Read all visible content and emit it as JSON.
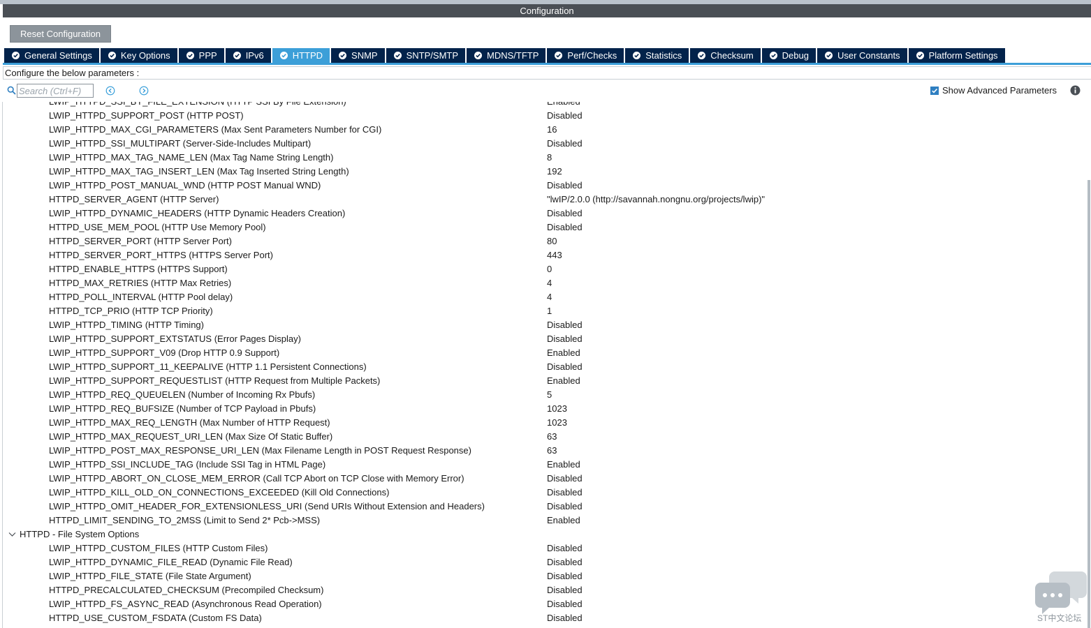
{
  "window": {
    "title": "Configuration"
  },
  "toolbar": {
    "reset_label": "Reset Configuration"
  },
  "tabs": [
    {
      "label": "General Settings",
      "active": false
    },
    {
      "label": "Key Options",
      "active": false
    },
    {
      "label": "PPP",
      "active": false
    },
    {
      "label": "IPv6",
      "active": false
    },
    {
      "label": "HTTPD",
      "active": true
    },
    {
      "label": "SNMP",
      "active": false
    },
    {
      "label": "SNTP/SMTP",
      "active": false
    },
    {
      "label": "MDNS/TFTP",
      "active": false
    },
    {
      "label": "Perf/Checks",
      "active": false
    },
    {
      "label": "Statistics",
      "active": false
    },
    {
      "label": "Checksum",
      "active": false
    },
    {
      "label": "Debug",
      "active": false
    },
    {
      "label": "User Constants",
      "active": false
    },
    {
      "label": "Platform Settings",
      "active": false
    }
  ],
  "configure_text": "Configure the below parameters :",
  "search": {
    "placeholder": "Search (Ctrl+F)"
  },
  "advanced": {
    "label": "Show Advanced Parameters",
    "checked": true
  },
  "rows": [
    {
      "name": "LWIP_HTTPD_SSI_BY_FILE_EXTENSION (HTTP SSI By File Extension)",
      "value": "Enabled"
    },
    {
      "name": "LWIP_HTTPD_SUPPORT_POST (HTTP POST)",
      "value": "Disabled"
    },
    {
      "name": "LWIP_HTTPD_MAX_CGI_PARAMETERS (Max Sent Parameters Number for CGI)",
      "value": "16"
    },
    {
      "name": "LWIP_HTTPD_SSI_MULTIPART (Server-Side-Includes Multipart)",
      "value": "Disabled"
    },
    {
      "name": "LWIP_HTTPD_MAX_TAG_NAME_LEN (Max Tag Name String Length)",
      "value": "8"
    },
    {
      "name": "LWIP_HTTPD_MAX_TAG_INSERT_LEN (Max Tag Inserted String Length)",
      "value": "192"
    },
    {
      "name": "LWIP_HTTPD_POST_MANUAL_WND (HTTP POST Manual WND)",
      "value": "Disabled"
    },
    {
      "name": "HTTPD_SERVER_AGENT (HTTP Server)",
      "value": "\"lwIP/2.0.0 (http://savannah.nongnu.org/projects/lwip)\""
    },
    {
      "name": "LWIP_HTTPD_DYNAMIC_HEADERS (HTTP Dynamic Headers Creation)",
      "value": "Disabled"
    },
    {
      "name": "HTTPD_USE_MEM_POOL (HTTP Use Memory Pool)",
      "value": "Disabled"
    },
    {
      "name": "HTTPD_SERVER_PORT (HTTP Server Port)",
      "value": "80"
    },
    {
      "name": "HTTPD_SERVER_PORT_HTTPS (HTTPS Server Port)",
      "value": "443"
    },
    {
      "name": "HTTPD_ENABLE_HTTPS (HTTPS Support)",
      "value": "0"
    },
    {
      "name": "HTTPD_MAX_RETRIES (HTTP Max Retries)",
      "value": "4"
    },
    {
      "name": "HTTPD_POLL_INTERVAL (HTTP Pool delay)",
      "value": "4"
    },
    {
      "name": "HTTPD_TCP_PRIO (HTTP TCP Priority)",
      "value": "1"
    },
    {
      "name": "LWIP_HTTPD_TIMING (HTTP Timing)",
      "value": "Disabled"
    },
    {
      "name": "LWIP_HTTPD_SUPPORT_EXTSTATUS (Error Pages Display)",
      "value": "Disabled"
    },
    {
      "name": "LWIP_HTTPD_SUPPORT_V09 (Drop HTTP 0.9 Support)",
      "value": "Enabled"
    },
    {
      "name": "LWIP_HTTPD_SUPPORT_11_KEEPALIVE (HTTP 1.1 Persistent Connections)",
      "value": "Disabled"
    },
    {
      "name": "LWIP_HTTPD_SUPPORT_REQUESTLIST (HTTP Request from Multiple Packets)",
      "value": "Enabled"
    },
    {
      "name": "LWIP_HTTPD_REQ_QUEUELEN (Number of Incoming Rx Pbufs)",
      "value": "5"
    },
    {
      "name": "LWIP_HTTPD_REQ_BUFSIZE (Number of TCP Payload in Pbufs)",
      "value": "1023"
    },
    {
      "name": "LWIP_HTTPD_MAX_REQ_LENGTH (Max Number of HTTP Request)",
      "value": "1023"
    },
    {
      "name": "LWIP_HTTPD_MAX_REQUEST_URI_LEN (Max Size Of Static Buffer)",
      "value": "63"
    },
    {
      "name": "LWIP_HTTPD_POST_MAX_RESPONSE_URI_LEN (Max Filename Length in POST Request Response)",
      "value": "63"
    },
    {
      "name": "LWIP_HTTPD_SSI_INCLUDE_TAG (Include SSI Tag in HTML Page)",
      "value": "Enabled"
    },
    {
      "name": "LWIP_HTTPD_ABORT_ON_CLOSE_MEM_ERROR (Call TCP Abort on TCP Close with Memory Error)",
      "value": "Disabled"
    },
    {
      "name": "LWIP_HTTPD_KILL_OLD_ON_CONNECTIONS_EXCEEDED (Kill Old Connections)",
      "value": "Disabled"
    },
    {
      "name": "LWIP_HTTPD_OMIT_HEADER_FOR_EXTENSIONLESS_URI (Send URIs Without Extension and Headers)",
      "value": "Disabled"
    },
    {
      "name": "HTTPD_LIMIT_SENDING_TO_2MSS (Limit to Send 2* Pcb->MSS)",
      "value": "Enabled"
    }
  ],
  "category": {
    "label": "HTTPD - File System Options"
  },
  "fs_rows": [
    {
      "name": "LWIP_HTTPD_CUSTOM_FILES (HTTP Custom Files)",
      "value": "Disabled"
    },
    {
      "name": "LWIP_HTTPD_DYNAMIC_FILE_READ (Dynamic File Read)",
      "value": "Disabled"
    },
    {
      "name": "LWIP_HTTPD_FILE_STATE (File State Argument)",
      "value": "Disabled"
    },
    {
      "name": "HTTPD_PRECALCULATED_CHECKSUM (Precompiled Checksum)",
      "value": "Disabled"
    },
    {
      "name": "LWIP_HTTPD_FS_ASYNC_READ (Asynchronous Read Operation)",
      "value": "Disabled"
    },
    {
      "name": "HTTPD_USE_CUSTOM_FSDATA (Custom FS Data)",
      "value": "Disabled"
    }
  ],
  "watermark": {
    "text": "ST中文论坛"
  },
  "colors": {
    "tab_bg": "#03234b",
    "tab_active": "#3c9fd8",
    "title_bg": "#4a4f55"
  }
}
